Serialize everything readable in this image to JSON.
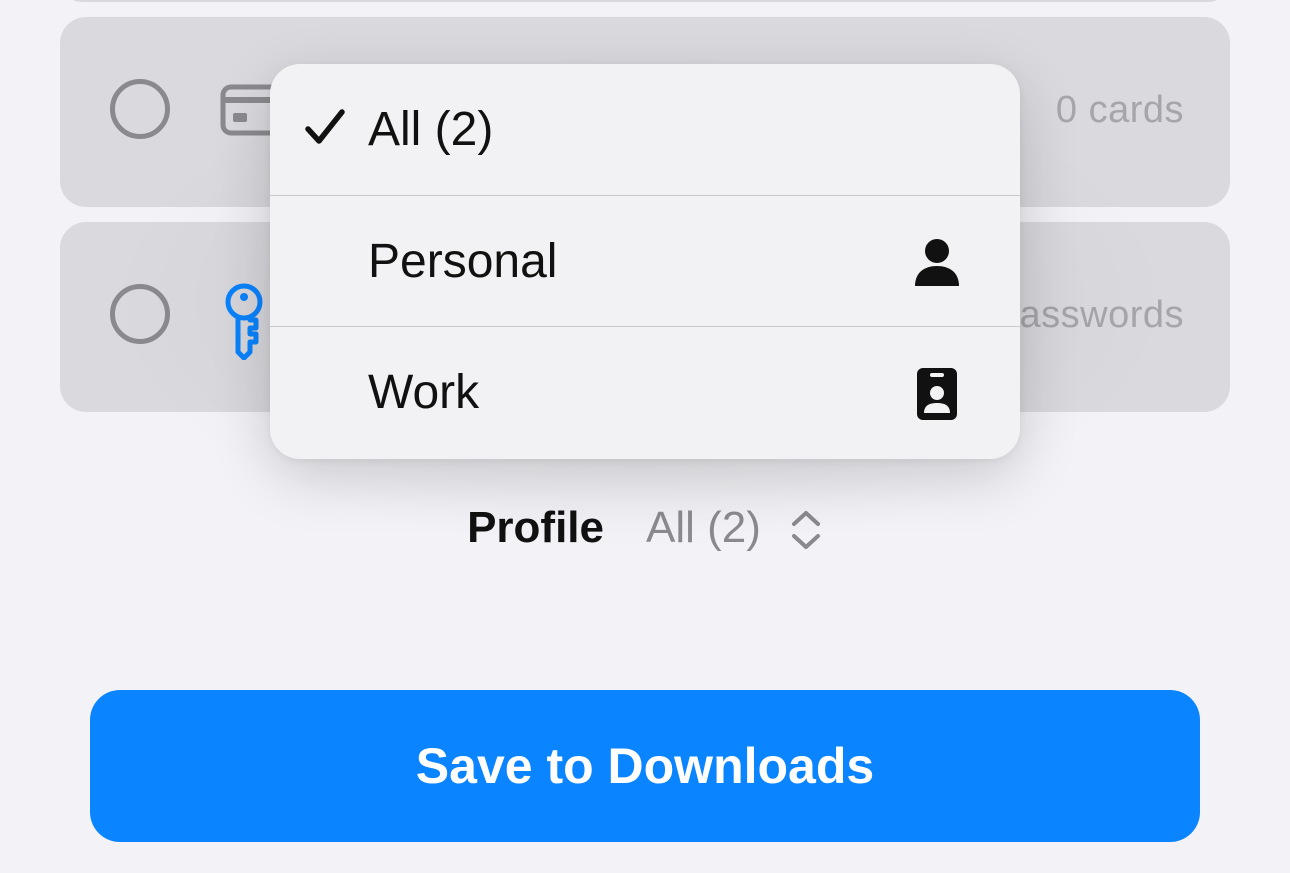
{
  "rows": [
    {
      "icon": "credit-card-icon",
      "count_label": "0 cards"
    },
    {
      "icon": "key-icon",
      "count_label": "asswords"
    }
  ],
  "menu": {
    "items": [
      {
        "label": "All (2)",
        "selected": true,
        "icon": "checkmark-icon"
      },
      {
        "label": "Personal",
        "selected": false,
        "icon": "person-icon"
      },
      {
        "label": "Work",
        "selected": false,
        "icon": "id-badge-icon"
      }
    ]
  },
  "profile": {
    "label": "Profile",
    "value": "All (2)",
    "icon": "chevron-up-down-icon"
  },
  "save_button": {
    "label": "Save to Downloads"
  },
  "colors": {
    "accent": "#0a84ff",
    "key_icon": "#0a84ff",
    "row_background": "#d9d9de",
    "menu_background": "#f2f2f4",
    "muted_text": "#a5a5aa"
  }
}
